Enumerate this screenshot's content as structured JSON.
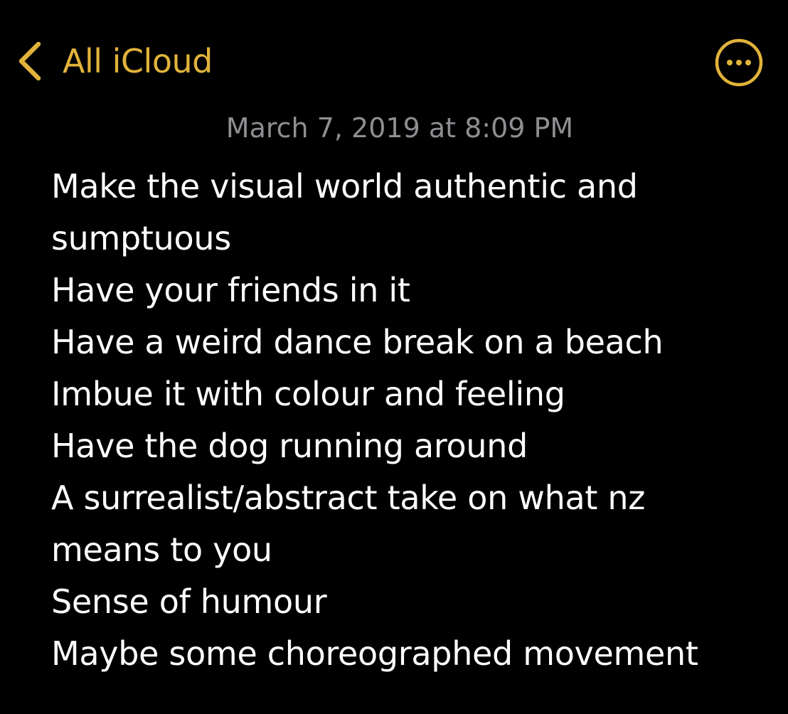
{
  "nav": {
    "back_label": "All iCloud",
    "back_icon": "chevron-left-icon",
    "more_icon": "ellipsis-circle-icon",
    "accent_color": "#e2b33b"
  },
  "note": {
    "timestamp": "March 7, 2019 at 8:09 PM",
    "lines": [
      "Make the visual world authentic and",
      "sumptuous",
      "Have your friends in it",
      "Have a weird dance break on a beach",
      "Imbue it with colour and feeling",
      "Have the dog running around",
      "A surrealist/abstract take on what nz",
      "means to you",
      "Sense of humour",
      "Maybe some choreographed movement"
    ]
  },
  "colors": {
    "background": "#000000",
    "text": "#ffffff",
    "timestamp": "#8e8e93"
  }
}
